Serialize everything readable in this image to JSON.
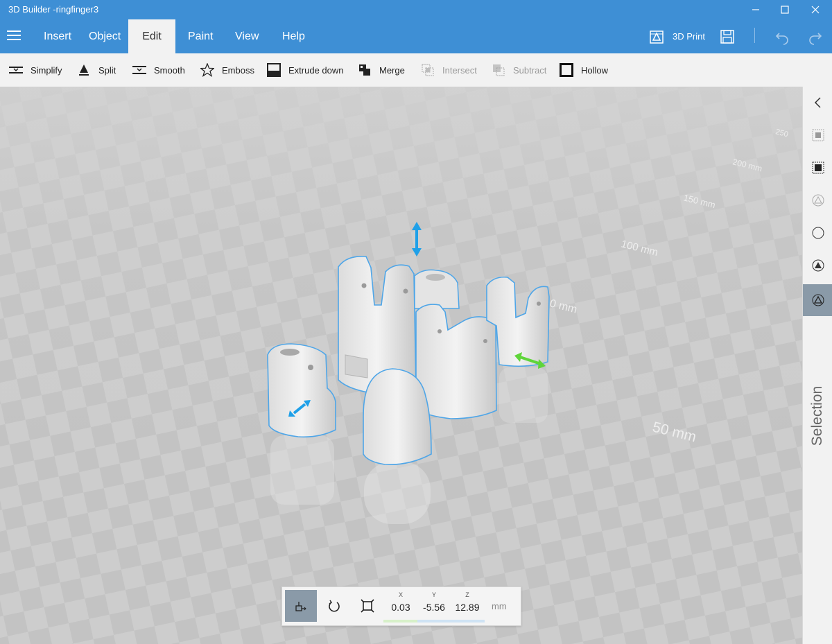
{
  "window": {
    "title": "3D Builder -ringfinger3"
  },
  "menu": {
    "tabs": [
      {
        "label": "Insert"
      },
      {
        "label": "Object"
      },
      {
        "label": "Edit"
      },
      {
        "label": "Paint"
      },
      {
        "label": "View"
      },
      {
        "label": "Help"
      }
    ],
    "active_tab": "Edit",
    "print_label": "3D Print"
  },
  "toolbar": {
    "items": [
      {
        "label": "Simplify",
        "enabled": true,
        "icon": "simplify-icon"
      },
      {
        "label": "Split",
        "enabled": true,
        "icon": "split-icon"
      },
      {
        "label": "Smooth",
        "enabled": true,
        "icon": "smooth-icon"
      },
      {
        "label": "Emboss",
        "enabled": true,
        "icon": "star-icon"
      },
      {
        "label": "Extrude down",
        "enabled": true,
        "icon": "extrude-down-icon"
      },
      {
        "label": "Merge",
        "enabled": true,
        "icon": "merge-icon"
      },
      {
        "label": "Intersect",
        "enabled": false,
        "icon": "intersect-icon"
      },
      {
        "label": "Subtract",
        "enabled": false,
        "icon": "subtract-icon"
      },
      {
        "label": "Hollow",
        "enabled": true,
        "icon": "hollow-icon"
      }
    ]
  },
  "viewport": {
    "scale_labels": [
      "250",
      "200 mm",
      "150 mm",
      "100 mm",
      "0 mm",
      "50 mm"
    ]
  },
  "right_panel": {
    "selection_label": "Selection"
  },
  "transform": {
    "x_label": "X",
    "y_label": "Y",
    "z_label": "Z",
    "x": "0.03",
    "y": "-5.56",
    "z": "12.89",
    "unit": "mm"
  },
  "colors": {
    "accent": "#3e8fd5",
    "selection_outline": "#4fa6e8",
    "gizmo_blue": "#1fa0e8",
    "gizmo_green": "#5fd53a",
    "toolbar_bg": "#f2f2f2",
    "active_button": "#8a9aa8"
  }
}
